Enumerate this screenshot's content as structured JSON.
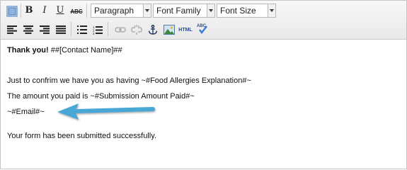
{
  "toolbar": {
    "row1": {
      "bold": "B",
      "italic": "I",
      "underline": "U",
      "strikethrough": "ABC",
      "paragraph_select": "Paragraph",
      "font_family_select": "Font Family",
      "font_size_select": "Font Size"
    },
    "row2": {
      "html": "HTML",
      "spellcheck": "ABC"
    }
  },
  "content": {
    "greeting_bold": "Thank you!",
    "greeting_rest": " ##[Contact Name]##",
    "line_allergies": "Just to confrim we have you as having ~#Food Allergies Explanation#~",
    "line_amount": "The amount you paid is ~#Submission Amount Paid#~",
    "line_email": "~#Email#~",
    "line_success": "Your form has been submitted successfully."
  },
  "colors": {
    "arrow": "#4aa7d6",
    "toolbar_bg": "#ececec",
    "border": "#c5c5c5"
  }
}
